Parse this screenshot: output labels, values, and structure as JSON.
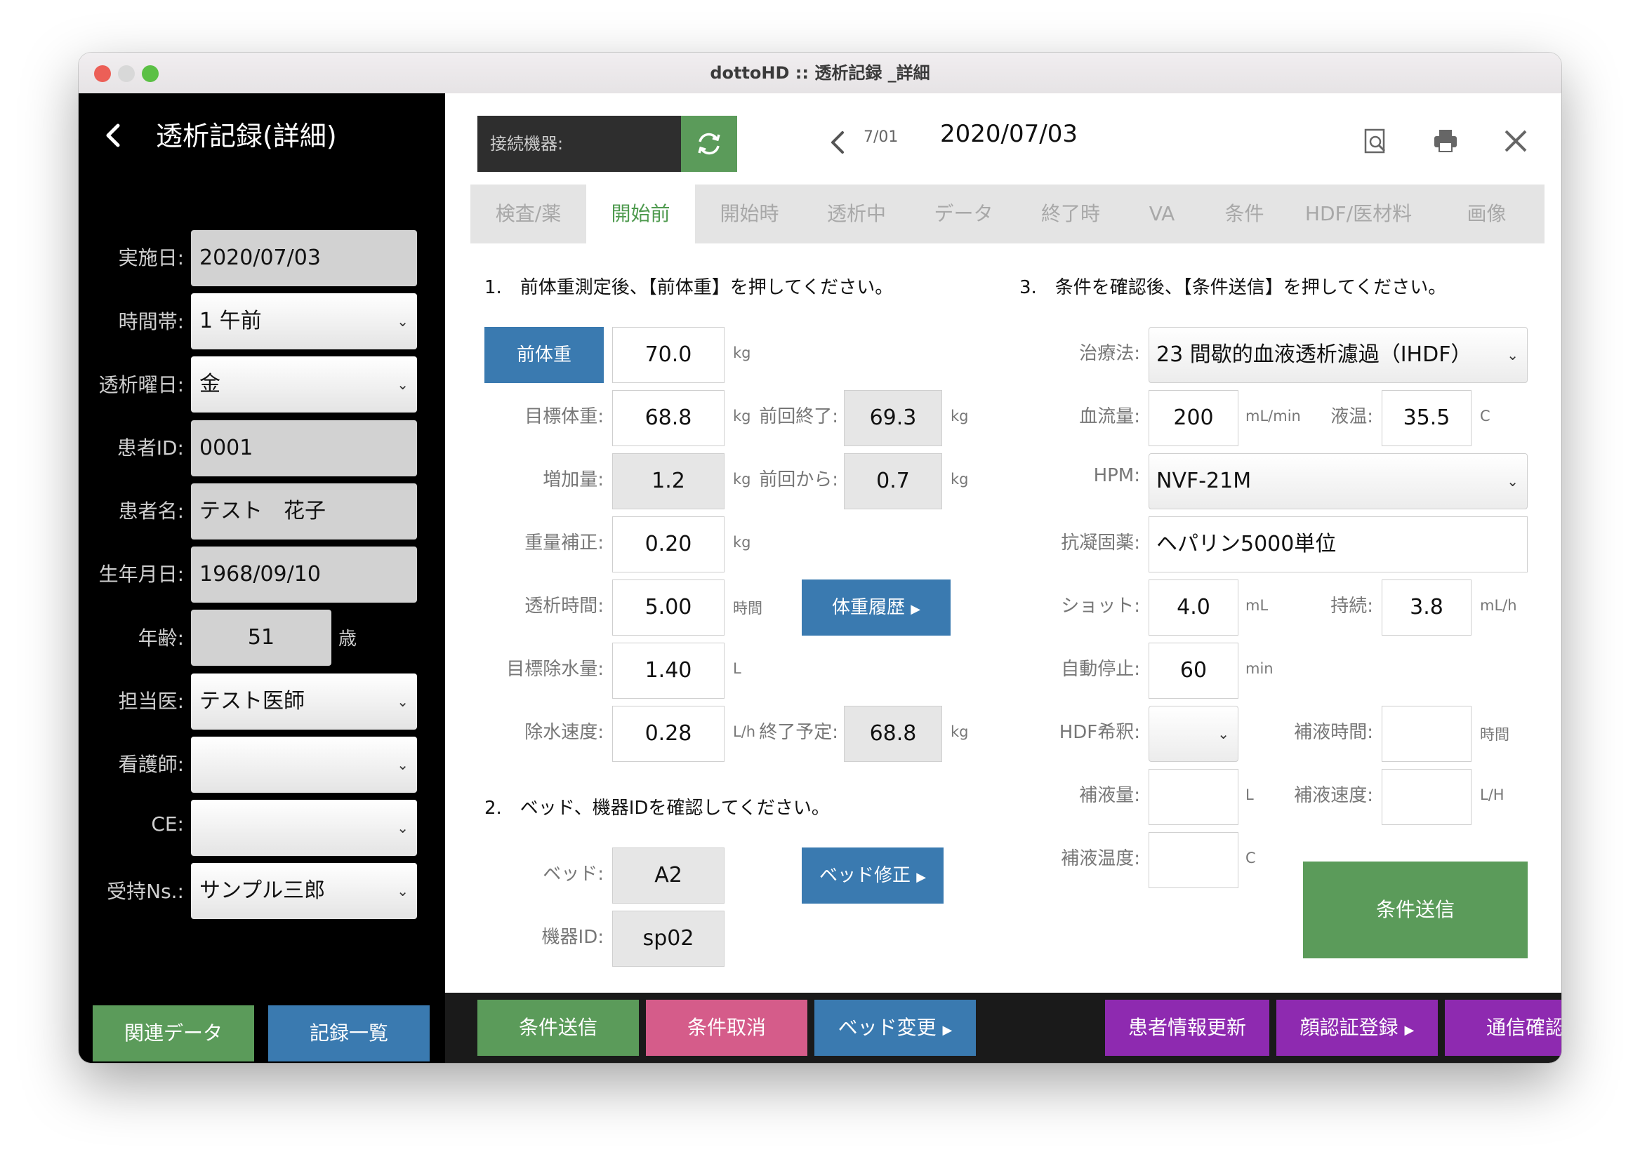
{
  "window": {
    "title": "dottoHD :: 透析記録 _詳細"
  },
  "sidebar": {
    "title": "透析記録(詳細)",
    "fields": [
      {
        "label": "実施日:",
        "value": "2020/07/03",
        "type": "readonly"
      },
      {
        "label": "時間帯:",
        "value": "1 午前",
        "type": "select"
      },
      {
        "label": "透析曜日:",
        "value": "金",
        "type": "select"
      },
      {
        "label": "患者ID:",
        "value": "0001",
        "type": "readonly"
      },
      {
        "label": "患者名:",
        "value": "テスト　花子",
        "type": "readonly"
      },
      {
        "label": "生年月日:",
        "value": "1968/09/10",
        "type": "readonly"
      },
      {
        "label": "年齢:",
        "value": "51",
        "unit": "歳",
        "type": "readonly"
      },
      {
        "label": "担当医:",
        "value": "テスト医師",
        "type": "select"
      },
      {
        "label": "看護師:",
        "value": "",
        "type": "select"
      },
      {
        "label": "CE:",
        "value": "",
        "type": "select"
      },
      {
        "label": "受持Ns.:",
        "value": "サンプル三郎",
        "type": "select"
      }
    ],
    "buttons": {
      "related": "関連データ",
      "records": "記録一覧"
    }
  },
  "header": {
    "device_label": "接続機器:",
    "page_counter": "7/01",
    "date": "2020/07/03"
  },
  "tabs": [
    "検査/薬",
    "開始前",
    "開始時",
    "透析中",
    "データ",
    "終了時",
    "VA",
    "条件",
    "HDF/医材料",
    "画像"
  ],
  "active_tab": 1,
  "section1": {
    "instruction": "1.　前体重測定後、【前体重】を押してください。",
    "pre_weight_button": "前体重",
    "pre_weight": "70.0",
    "target_weight_label": "目標体重:",
    "target_weight": "68.8",
    "prev_end_label": "前回終了:",
    "prev_end": "69.3",
    "increase_label": "増加量:",
    "increase": "1.2",
    "from_prev_label": "前回から:",
    "from_prev": "0.7",
    "correction_label": "重量補正:",
    "correction": "0.20",
    "dialysis_time_label": "透析時間:",
    "dialysis_time": "5.00",
    "target_removal_label": "目標除水量:",
    "target_removal": "1.40",
    "removal_rate_label": "除水速度:",
    "removal_rate": "0.28",
    "planned_end_label": "終了予定:",
    "planned_end": "68.8",
    "weight_history_button": "体重履歴",
    "units": {
      "kg": "kg",
      "hours": "時間",
      "liter": "L",
      "lph": "L/h"
    }
  },
  "section2": {
    "instruction": "2.　ベッド、機器IDを確認してください。",
    "bed_label": "ベッド:",
    "bed": "A2",
    "device_id_label": "機器ID:",
    "device_id": "sp02",
    "bed_edit_button": "ベッド修正"
  },
  "section3": {
    "instruction": "3.　条件を確認後、【条件送信】を押してください。",
    "therapy_label": "治療法:",
    "therapy": "23 間歇的血液透析濾過（IHDF）",
    "blood_flow_label": "血流量:",
    "blood_flow": "200",
    "blood_flow_unit": "mL/min",
    "temp_label": "液温:",
    "temp": "35.5",
    "temp_unit": "C",
    "hpm_label": "HPM:",
    "hpm": "NVF-21M",
    "anticoag_label": "抗凝固薬:",
    "anticoag": "ヘパリン5000単位",
    "shot_label": "ショット:",
    "shot": "4.0",
    "shot_unit": "mL",
    "continuous_label": "持続:",
    "continuous": "3.8",
    "continuous_unit": "mL/h",
    "auto_stop_label": "自動停止:",
    "auto_stop": "60",
    "auto_stop_unit": "min",
    "hdf_dilution_label": "HDF希釈:",
    "hdf_dilution": "",
    "sub_time_label": "補液時間:",
    "sub_time": "",
    "sub_time_unit": "時間",
    "sub_volume_label": "補液量:",
    "sub_volume": "",
    "sub_volume_unit": "L",
    "sub_rate_label": "補液速度:",
    "sub_rate": "",
    "sub_rate_unit": "L/H",
    "sub_temp_label": "補液温度:",
    "sub_temp": "",
    "sub_temp_unit": "C",
    "send_button": "条件送信"
  },
  "bottom_bar": {
    "send": "条件送信",
    "cancel": "条件取消",
    "bed_change": "ベッド変更",
    "patient_update": "患者情報更新",
    "face_register": "顔認証登録",
    "comm_check": "通信確認"
  },
  "colors": {
    "green": "#5b9b5a",
    "blue": "#3a7ab0",
    "pink": "#d55c8a",
    "purple": "#8e2ab0"
  }
}
